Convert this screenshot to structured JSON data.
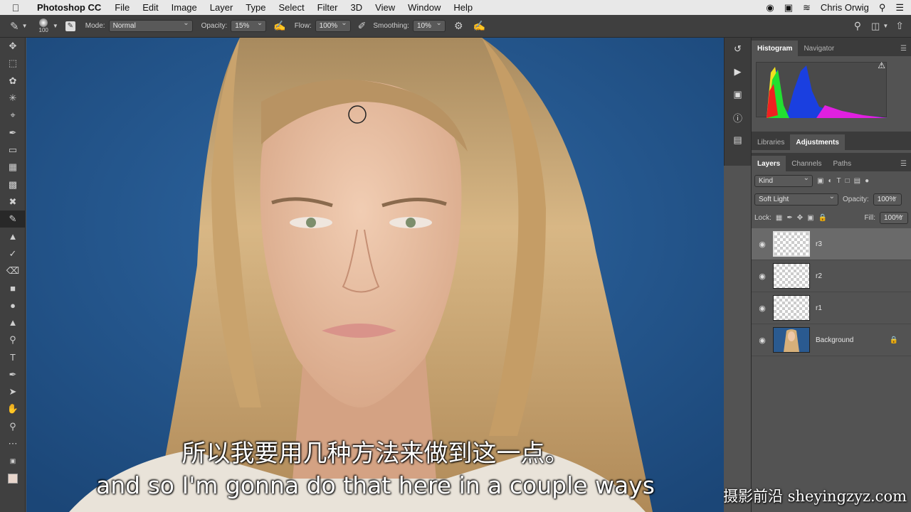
{
  "menubar": {
    "app_name": "Photoshop CC",
    "items": [
      "File",
      "Edit",
      "Image",
      "Layer",
      "Type",
      "Select",
      "Filter",
      "3D",
      "View",
      "Window",
      "Help"
    ],
    "user": "Chris Orwig"
  },
  "options": {
    "brush_size": "100",
    "mode_label": "Mode:",
    "mode_value": "Normal",
    "opacity_label": "Opacity:",
    "opacity_value": "15%",
    "flow_label": "Flow:",
    "flow_value": "100%",
    "smoothing_label": "Smoothing:",
    "smoothing_value": "10%"
  },
  "panels": {
    "top_tabs": [
      "Histogram",
      "Navigator"
    ],
    "mid_tabs": [
      "Libraries",
      "Adjustments"
    ],
    "layer_tabs": [
      "Layers",
      "Channels",
      "Paths"
    ],
    "filter_kind": "Kind",
    "blend_mode": "Soft Light",
    "opacity_label": "Opacity:",
    "opacity_value": "100%",
    "lock_label": "Lock:",
    "fill_label": "Fill:",
    "fill_value": "100%",
    "layers": [
      {
        "name": "r3",
        "selected": true
      },
      {
        "name": "r2",
        "selected": false
      },
      {
        "name": "r1",
        "selected": false
      },
      {
        "name": "Background",
        "selected": false
      }
    ]
  },
  "subtitles": {
    "chinese": "所以我要用几种方法来做到这一点。",
    "english": "and so I'm gonna do that here in a couple ways"
  },
  "watermark": "摄影前沿 sheyingzyz.com",
  "colors": {
    "canvas_bg": "#24548a",
    "panel_bg": "#535353",
    "toolbar_bg": "#404040",
    "menubar_bg": "#e8e8e8"
  }
}
